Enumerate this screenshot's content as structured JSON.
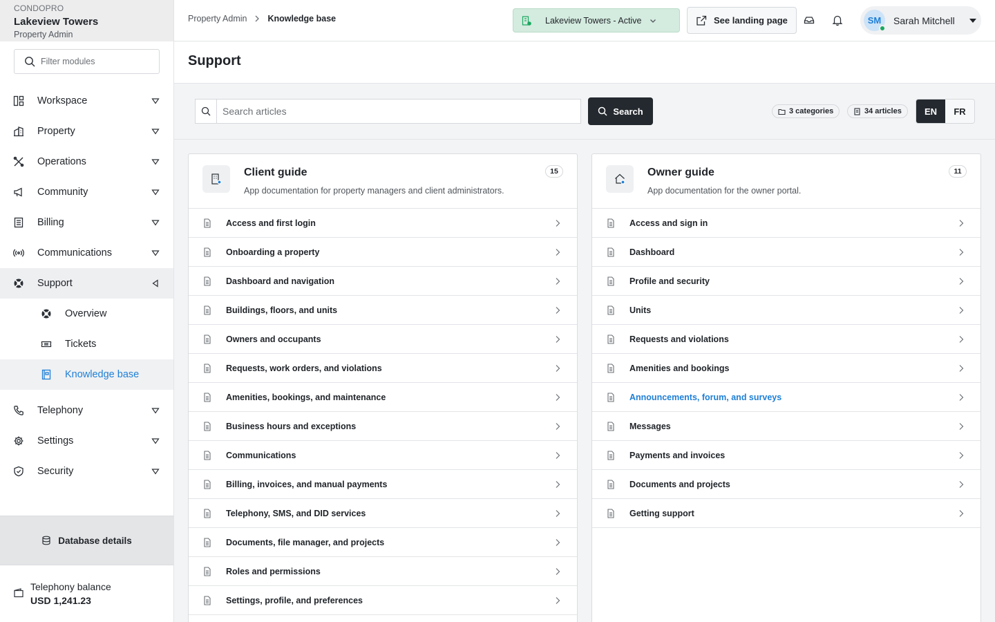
{
  "brand": {
    "app": "CONDOPRO",
    "property": "Lakeview Towers",
    "role": "Property Admin"
  },
  "sidebar": {
    "filter_placeholder": "Filter modules",
    "items": [
      {
        "label": "Workspace"
      },
      {
        "label": "Property"
      },
      {
        "label": "Operations"
      },
      {
        "label": "Community"
      },
      {
        "label": "Billing"
      },
      {
        "label": "Communications"
      },
      {
        "label": "Support"
      },
      {
        "label": "Telephony"
      },
      {
        "label": "Settings"
      },
      {
        "label": "Security"
      }
    ],
    "support_children": [
      {
        "label": "Overview"
      },
      {
        "label": "Tickets"
      },
      {
        "label": "Knowledge base"
      }
    ],
    "db_details": "Database details",
    "balance_label": "Telephony balance",
    "balance_value": "USD 1,241.23"
  },
  "topbar": {
    "breadcrumb_root": "Property Admin",
    "breadcrumb_current": "Knowledge base",
    "property_select": "Lakeview Towers - Active",
    "landing_button": "See landing page",
    "user_initials": "SM",
    "user_name": "Sarah Mitchell"
  },
  "page": {
    "title": "Support"
  },
  "search": {
    "placeholder": "Search articles",
    "button": "Search",
    "categories_badge": "3 categories",
    "articles_badge": "34 articles",
    "lang_en": "EN",
    "lang_fr": "FR"
  },
  "client_guide": {
    "title": "Client guide",
    "description": "App documentation for property managers and client administrators.",
    "count": "15",
    "articles": [
      "Access and first login",
      "Onboarding a property",
      "Dashboard and navigation",
      "Buildings, floors, and units",
      "Owners and occupants",
      "Requests, work orders, and violations",
      "Amenities, bookings, and maintenance",
      "Business hours and exceptions",
      "Communications",
      "Billing, invoices, and manual payments",
      "Telephony, SMS, and DID services",
      "Documents, file manager, and projects",
      "Roles and permissions",
      "Settings, profile, and preferences"
    ]
  },
  "owner_guide": {
    "title": "Owner guide",
    "description": "App documentation for the owner portal.",
    "count": "11",
    "articles": [
      "Access and sign in",
      "Dashboard",
      "Profile and security",
      "Units",
      "Requests and violations",
      "Amenities and bookings",
      "Announcements, forum, and surveys",
      "Messages",
      "Payments and invoices",
      "Documents and projects",
      "Getting support"
    ]
  },
  "colors": {
    "accent": "#1e7fd6",
    "dark": "#24292f",
    "active_property": "#d4ebdf",
    "online": "#1aa760"
  }
}
